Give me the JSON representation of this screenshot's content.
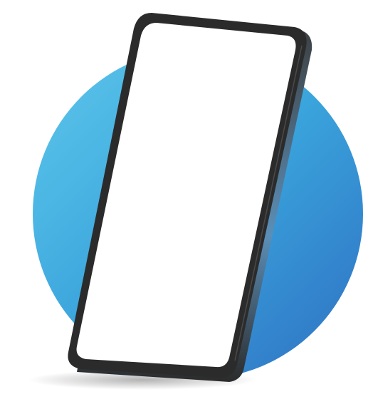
{
  "illustration": {
    "subject": "tilted-smartphone-blank-screen",
    "colors": {
      "circle_light": "#5ec8ec",
      "circle_mid": "#3aa4dc",
      "circle_dark": "#2e6fc2",
      "phone_frame": "#2b2b2b",
      "phone_edge_highlight": "#5b8fb8",
      "screen": "#ffffff",
      "shadow": "#9a9a9a",
      "background": "#ffffff"
    }
  }
}
